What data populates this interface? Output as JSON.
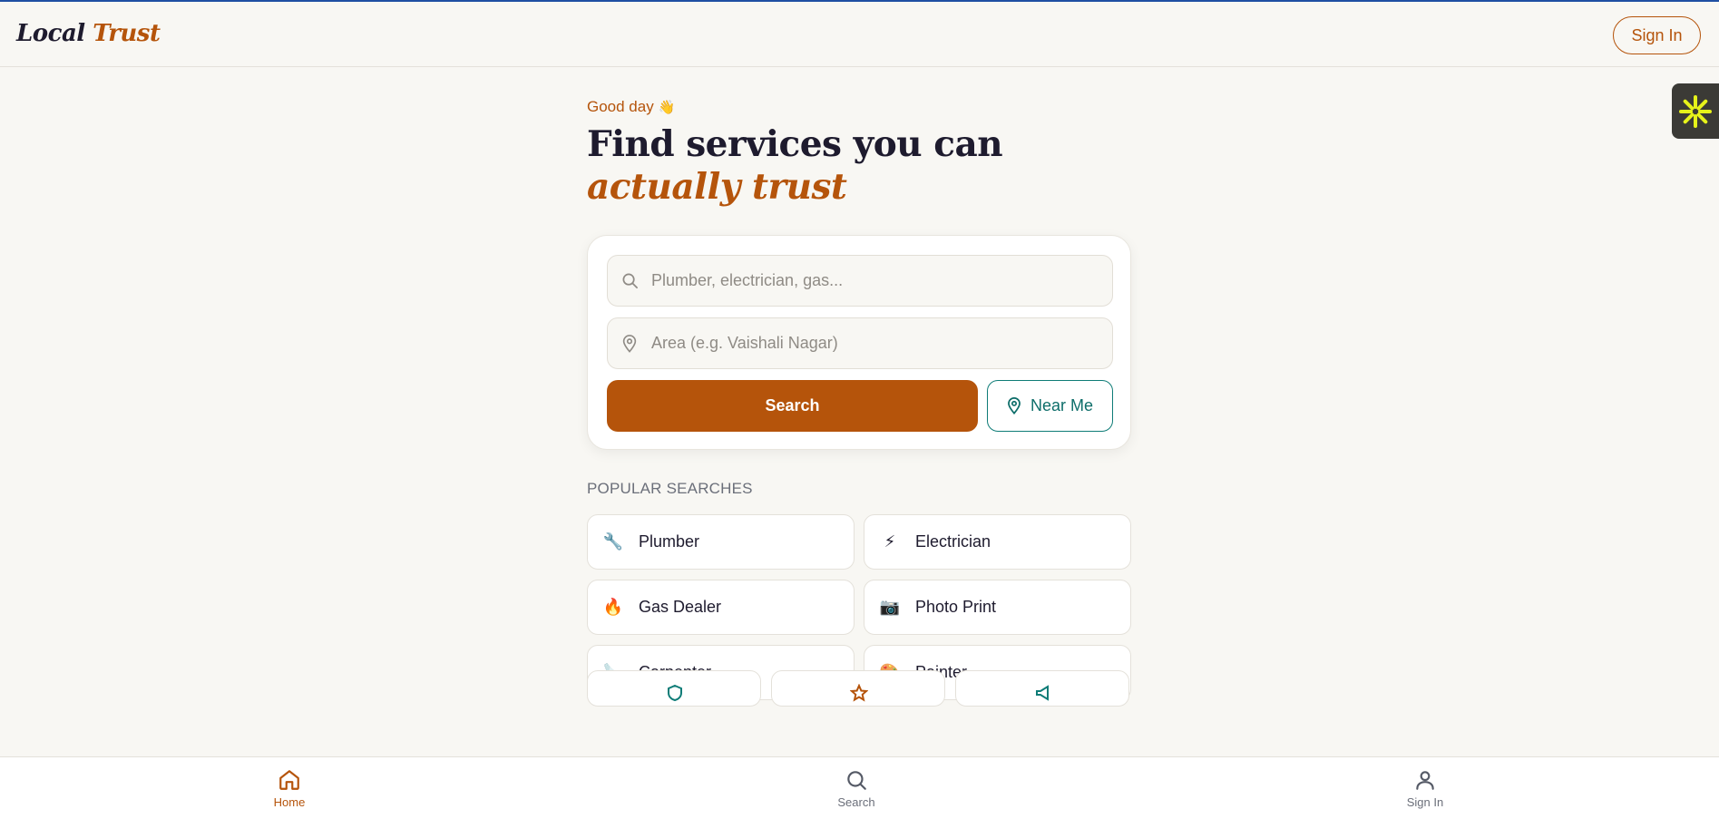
{
  "header": {
    "logo_part1": "Local",
    "logo_part2": "Trust",
    "signin_label": "Sign In"
  },
  "hero": {
    "greeting": "Good day",
    "greeting_emoji": "👋",
    "headline_line1": "Find services you can",
    "headline_line2": "actually trust"
  },
  "search": {
    "service_placeholder": "Plumber, electrician, gas...",
    "area_placeholder": "Area (e.g. Vaishali Nagar)",
    "search_label": "Search",
    "near_me_label": "Near Me"
  },
  "popular": {
    "title": "POPULAR SEARCHES",
    "items": [
      {
        "label": "Plumber",
        "icon": "🔧",
        "icon_name": "wrench-icon"
      },
      {
        "label": "Electrician",
        "icon": "⚡",
        "icon_name": "lightning-icon"
      },
      {
        "label": "Gas Dealer",
        "icon": "🔥",
        "icon_name": "fire-icon"
      },
      {
        "label": "Photo Print",
        "icon": "📷",
        "icon_name": "camera-icon"
      },
      {
        "label": "Carpenter",
        "icon": "🪚",
        "icon_name": "saw-icon"
      },
      {
        "label": "Painter",
        "icon": "🎨",
        "icon_name": "palette-icon"
      }
    ]
  },
  "bottom_nav": {
    "home": "Home",
    "search": "Search",
    "signin": "Sign In"
  },
  "colors": {
    "brand": "#b5540b",
    "teal": "#0e7c77",
    "background": "#f8f7f3",
    "text": "#1e1b2e"
  }
}
